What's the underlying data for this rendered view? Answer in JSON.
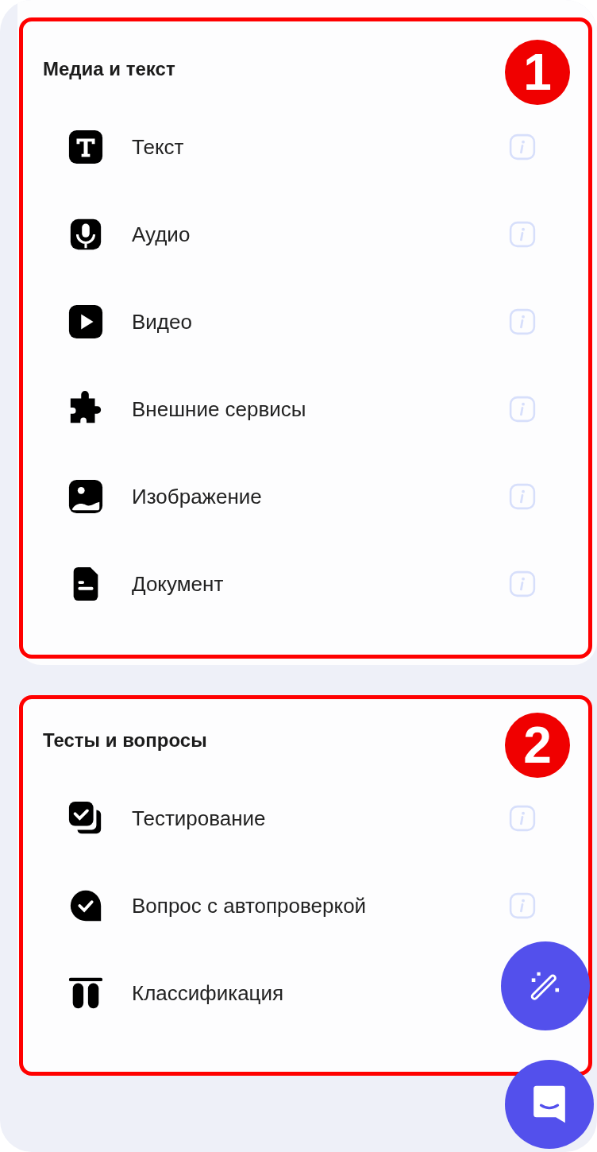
{
  "sections": [
    {
      "title": "Медиа и текст",
      "annotation": "1",
      "items": [
        {
          "label": "Текст",
          "kind": "text",
          "info": true
        },
        {
          "label": "Аудио",
          "kind": "audio",
          "info": true
        },
        {
          "label": "Видео",
          "kind": "video",
          "info": true
        },
        {
          "label": "Внешние сервисы",
          "kind": "puzzle",
          "info": true
        },
        {
          "label": "Изображение",
          "kind": "image",
          "info": true
        },
        {
          "label": "Документ",
          "kind": "document",
          "info": true
        }
      ]
    },
    {
      "title": "Тесты и вопросы",
      "annotation": "2",
      "items": [
        {
          "label": "Тестирование",
          "kind": "testing",
          "info": true
        },
        {
          "label": "Вопрос с автопроверкой",
          "kind": "question",
          "info": true
        },
        {
          "label": "Классификация",
          "kind": "classify",
          "info": false
        }
      ]
    }
  ]
}
